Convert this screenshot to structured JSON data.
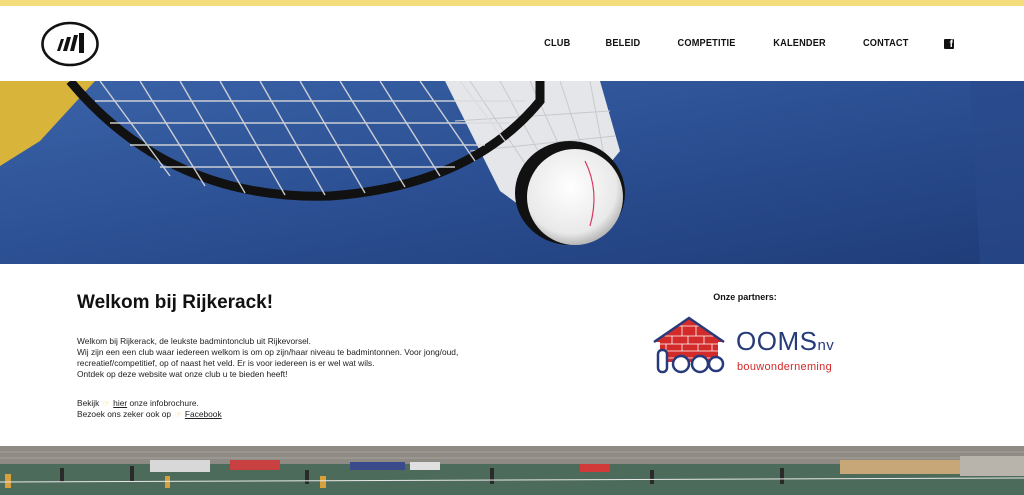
{
  "nav": {
    "items": [
      "CLUB",
      "BELEID",
      "COMPETITIE",
      "KALENDER",
      "CONTACT"
    ],
    "facebook_icon": "facebook-icon"
  },
  "colors": {
    "topbar": "#f5dc7a",
    "ooms_blue": "#273a7a",
    "ooms_red": "#d32a2a"
  },
  "welcome": {
    "title": "Welkom bij Rijkerack!",
    "line1": "Welkom bij Rijkerack, de leukste badmintonclub uit Rijkevorsel.",
    "line2": "Wij zijn een een club waar iedereen welkom is om op zijn/haar niveau te badmintonnen. Voor jong/oud, recreatief/competitief, op of naast het veld. Er is voor iedereen is er wel wat wils.",
    "line3": "Ontdek op deze website wat onze club u te bieden heeft!",
    "brochure_prefix": "Bekijk",
    "brochure_link": "hier",
    "brochure_suffix": "onze infobrochure.",
    "facebook_prefix": "Bezoek ons zeker ook op",
    "facebook_link": "Facebook"
  },
  "partners": {
    "title": "Onze partners:",
    "ooms_name": "OOMS",
    "ooms_suffix": "nv",
    "ooms_sub": "bouwonderneming"
  }
}
